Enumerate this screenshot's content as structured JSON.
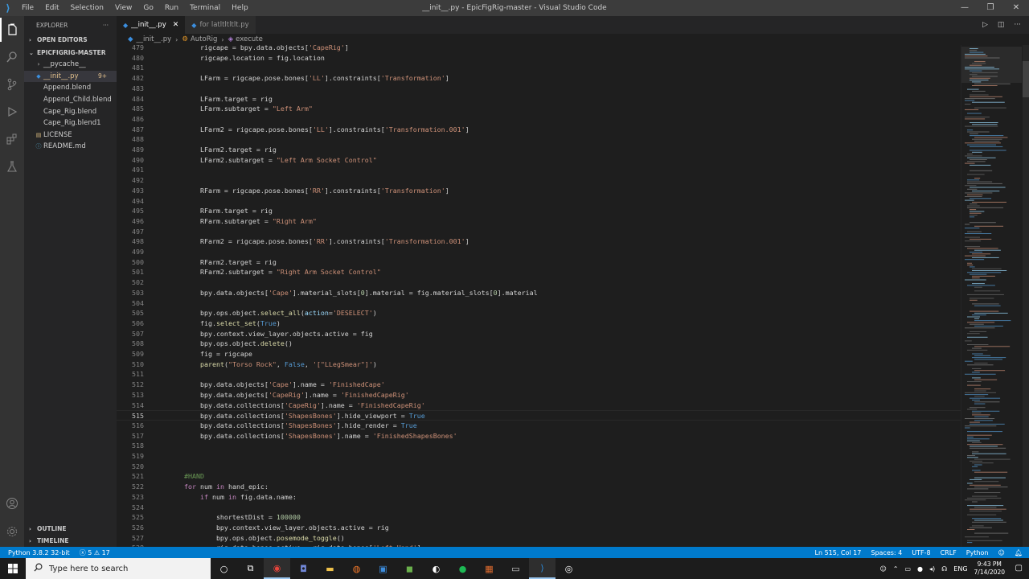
{
  "app": {
    "window_title": "__init__.py - EpicFigRig-master - Visual Studio Code",
    "menu": [
      "File",
      "Edit",
      "Selection",
      "View",
      "Go",
      "Run",
      "Terminal",
      "Help"
    ]
  },
  "sidebar": {
    "title": "EXPLORER",
    "open_editors": "OPEN EDITORS",
    "project": "EPICFIGRIG-MASTER",
    "items": [
      {
        "label": "__pycache__",
        "type": "folder"
      },
      {
        "label": "__init__.py",
        "type": "python",
        "badge": "9+"
      },
      {
        "label": "Append.blend",
        "type": "file"
      },
      {
        "label": "Append_Child.blend",
        "type": "file"
      },
      {
        "label": "Cape_Rig.blend",
        "type": "file"
      },
      {
        "label": "Cape_Rig.blend1",
        "type": "file"
      },
      {
        "label": "LICENSE",
        "type": "license"
      },
      {
        "label": "README.md",
        "type": "info"
      }
    ],
    "outline": "OUTLINE",
    "timeline": "TIMELINE"
  },
  "tabs": [
    {
      "label": "__init__.py",
      "active": true
    },
    {
      "label": "for latltltltlt.py",
      "active": false
    }
  ],
  "breadcrumb": [
    "__init__.py",
    "AutoRig",
    "execute"
  ],
  "code": {
    "current_line": 515,
    "lines": [
      {
        "n": 479,
        "t": "        rigcape = bpy.data.objects['CapeRig']"
      },
      {
        "n": 480,
        "t": "        rigcape.location = fig.location"
      },
      {
        "n": 481,
        "t": ""
      },
      {
        "n": 482,
        "t": "        LFarm = rigcape.pose.bones['LL'].constraints['Transformation']"
      },
      {
        "n": 483,
        "t": ""
      },
      {
        "n": 484,
        "t": "        LFarm.target = rig"
      },
      {
        "n": 485,
        "t": "        LFarm.subtarget = \"Left Arm\""
      },
      {
        "n": 486,
        "t": ""
      },
      {
        "n": 487,
        "t": "        LFarm2 = rigcape.pose.bones['LL'].constraints['Transformation.001']"
      },
      {
        "n": 488,
        "t": ""
      },
      {
        "n": 489,
        "t": "        LFarm2.target = rig"
      },
      {
        "n": 490,
        "t": "        LFarm2.subtarget = \"Left Arm Socket Control\""
      },
      {
        "n": 491,
        "t": ""
      },
      {
        "n": 492,
        "t": ""
      },
      {
        "n": 493,
        "t": "        RFarm = rigcape.pose.bones['RR'].constraints['Transformation']"
      },
      {
        "n": 494,
        "t": ""
      },
      {
        "n": 495,
        "t": "        RFarm.target = rig"
      },
      {
        "n": 496,
        "t": "        RFarm.subtarget = \"Right Arm\""
      },
      {
        "n": 497,
        "t": ""
      },
      {
        "n": 498,
        "t": "        RFarm2 = rigcape.pose.bones['RR'].constraints['Transformation.001']"
      },
      {
        "n": 499,
        "t": ""
      },
      {
        "n": 500,
        "t": "        RFarm2.target = rig"
      },
      {
        "n": 501,
        "t": "        RFarm2.subtarget = \"Right Arm Socket Control\""
      },
      {
        "n": 502,
        "t": ""
      },
      {
        "n": 503,
        "t": "        bpy.data.objects['Cape'].material_slots[0].material = fig.material_slots[0].material"
      },
      {
        "n": 504,
        "t": ""
      },
      {
        "n": 505,
        "t": "        bpy.ops.object.select_all(action='DESELECT')"
      },
      {
        "n": 506,
        "t": "        fig.select_set(True)"
      },
      {
        "n": 507,
        "t": "        bpy.context.view_layer.objects.active = fig"
      },
      {
        "n": 508,
        "t": "        bpy.ops.object.delete()"
      },
      {
        "n": 509,
        "t": "        fig = rigcape"
      },
      {
        "n": 510,
        "t": "        parent(\"Torso Rock\", False, '[\"LLegSmear\"]')"
      },
      {
        "n": 511,
        "t": ""
      },
      {
        "n": 512,
        "t": "        bpy.data.objects['Cape'].name = 'FinishedCape'"
      },
      {
        "n": 513,
        "t": "        bpy.data.objects['CapeRig'].name = 'FinishedCapeRig'"
      },
      {
        "n": 514,
        "t": "        bpy.data.collections['CapeRig'].name = 'FinishedCapeRig'"
      },
      {
        "n": 515,
        "t": "        bpy.data.collections['ShapesBones'].hide_viewport = True"
      },
      {
        "n": 516,
        "t": "        bpy.data.collections['ShapesBones'].hide_render = True"
      },
      {
        "n": 517,
        "t": "        bpy.data.collections['ShapesBones'].name = 'FinishedShapesBones'"
      },
      {
        "n": 518,
        "t": ""
      },
      {
        "n": 519,
        "t": ""
      },
      {
        "n": 520,
        "t": ""
      },
      {
        "n": 521,
        "t": "    #HAND"
      },
      {
        "n": 522,
        "t": "    for num in hand_epic:"
      },
      {
        "n": 523,
        "t": "        if num in fig.data.name:"
      },
      {
        "n": 524,
        "t": ""
      },
      {
        "n": 525,
        "t": "            shortestDist = 100000"
      },
      {
        "n": 526,
        "t": "            bpy.context.view_layer.objects.active = rig"
      },
      {
        "n": 527,
        "t": "            bpy.ops.object.posemode_toggle()"
      },
      {
        "n": 528,
        "t": "            rig.data.bones.active = rig.data.bones['Left Hand']"
      }
    ]
  },
  "statusbar": {
    "interpreter": "Python 3.8.2 32-bit",
    "errors": "5",
    "warnings": "17",
    "position": "Ln 515, Col 17",
    "spaces": "Spaces: 4",
    "encoding": "UTF-8",
    "eol": "CRLF",
    "language": "Python"
  },
  "taskbar": {
    "search_placeholder": "Type here to search",
    "language": "ENG",
    "time": "9:43 PM",
    "date": "7/14/2020"
  }
}
